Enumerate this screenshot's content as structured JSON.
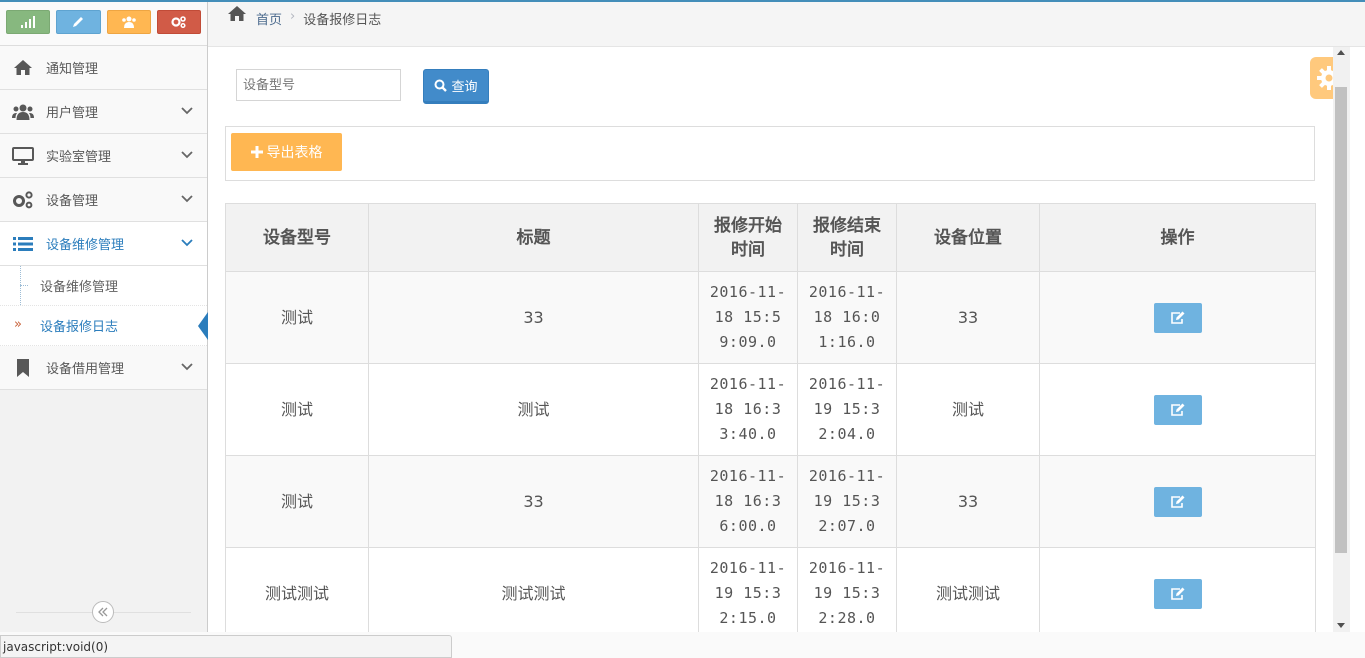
{
  "breadcrumb": {
    "home": "首页",
    "current": "设备报修日志"
  },
  "sidebar": {
    "shortcuts": [
      {
        "icon": "signal-icon",
        "color": "#87b87f"
      },
      {
        "icon": "pencil-icon",
        "color": "#6fb3e0"
      },
      {
        "icon": "users-icon",
        "color": "#ffb752"
      },
      {
        "icon": "cogs-icon",
        "color": "#d15b47"
      }
    ],
    "items": [
      {
        "label": "通知管理",
        "icon": "home-icon"
      },
      {
        "label": "用户管理",
        "icon": "users-icon"
      },
      {
        "label": "实验室管理",
        "icon": "desktop-icon"
      },
      {
        "label": "设备管理",
        "icon": "cogs-icon"
      },
      {
        "label": "设备维修管理",
        "icon": "list-icon"
      },
      {
        "label": "设备借用管理",
        "icon": "bookmark-icon"
      }
    ],
    "subitems": [
      {
        "label": "设备维修管理"
      },
      {
        "label": "设备报修日志"
      }
    ]
  },
  "search": {
    "placeholder": "设备型号",
    "button_label": "查询"
  },
  "toolbar": {
    "export_label": "导出表格"
  },
  "table": {
    "headers": {
      "model": "设备型号",
      "title": "标题",
      "start_line1": "报修开始",
      "start_line2": "时间",
      "end_line1": "报修结束",
      "end_line2": "时间",
      "location": "设备位置",
      "action": "操作"
    },
    "rows": [
      {
        "model": "测试",
        "title": "33",
        "start": "2016-11-18 15:59:09.0",
        "end": "2016-11-18 16:01:16.0",
        "location": "33"
      },
      {
        "model": "测试",
        "title": "测试",
        "start": "2016-11-18 16:33:40.0",
        "end": "2016-11-19 15:32:04.0",
        "location": "测试"
      },
      {
        "model": "测试",
        "title": "33",
        "start": "2016-11-18 16:36:00.0",
        "end": "2016-11-19 15:32:07.0",
        "location": "33"
      },
      {
        "model": "测试测试",
        "title": "测试测试",
        "start": "2016-11-19 15:32:15.0",
        "end": "2016-11-19 15:32:28.0",
        "location": "测试测试"
      }
    ]
  },
  "statusbar": {
    "text": "javascript:void(0)"
  },
  "colors": {
    "primary": "#428bca",
    "warning": "#ffb752",
    "info": "#6fb3e0",
    "active": "#2b7dbc"
  }
}
